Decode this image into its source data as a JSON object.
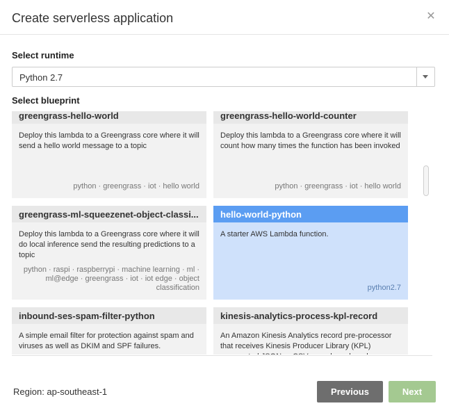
{
  "dialog": {
    "title": "Create serverless application"
  },
  "runtime": {
    "label": "Select runtime",
    "selected": "Python 2.7"
  },
  "blueprint": {
    "label": "Select blueprint",
    "cards": [
      {
        "title": "greengrass-hello-world",
        "description": "Deploy this lambda to a Greengrass core where it will send a hello world message to a topic",
        "tags": "python · greengrass · iot · hello world",
        "selected": false
      },
      {
        "title": "greengrass-hello-world-counter",
        "description": "Deploy this lambda to a Greengrass core where it will count how many times the function has been invoked",
        "tags": "python · greengrass · iot · hello world",
        "selected": false
      },
      {
        "title": "greengrass-ml-squeezenet-object-classi...",
        "description": "Deploy this lambda to a Greengrass core where it will do local inference send the resulting predictions to a topic",
        "tags": "python · raspi · raspberrypi · machine learning · ml · ml@edge · greengrass · iot · iot edge · object classification",
        "selected": false
      },
      {
        "title": "hello-world-python",
        "description": "A starter AWS Lambda function.",
        "tags": "python2.7",
        "selected": true
      },
      {
        "title": "inbound-ses-spam-filter-python",
        "description": "A simple email filter for protection against spam and viruses as well as DKIM and SPF failures.",
        "tags": "",
        "selected": false
      },
      {
        "title": "kinesis-analytics-process-kpl-record",
        "description": "An Amazon Kinesis Analytics record pre-processor that receives Kinesis Producer Library (KPL) aggregated JSON or CSV records and produces",
        "tags": "",
        "selected": false
      }
    ]
  },
  "footer": {
    "region": "Region: ap-southeast-1",
    "previous_label": "Previous",
    "next_label": "Next"
  },
  "icons": {
    "close": "close-icon",
    "dropdown": "chevron-down-icon"
  },
  "colors": {
    "selected_header": "#5b9df2",
    "selected_body": "#cfe1fb",
    "next_button": "#a4c991",
    "previous_button": "#6e6e6e"
  }
}
